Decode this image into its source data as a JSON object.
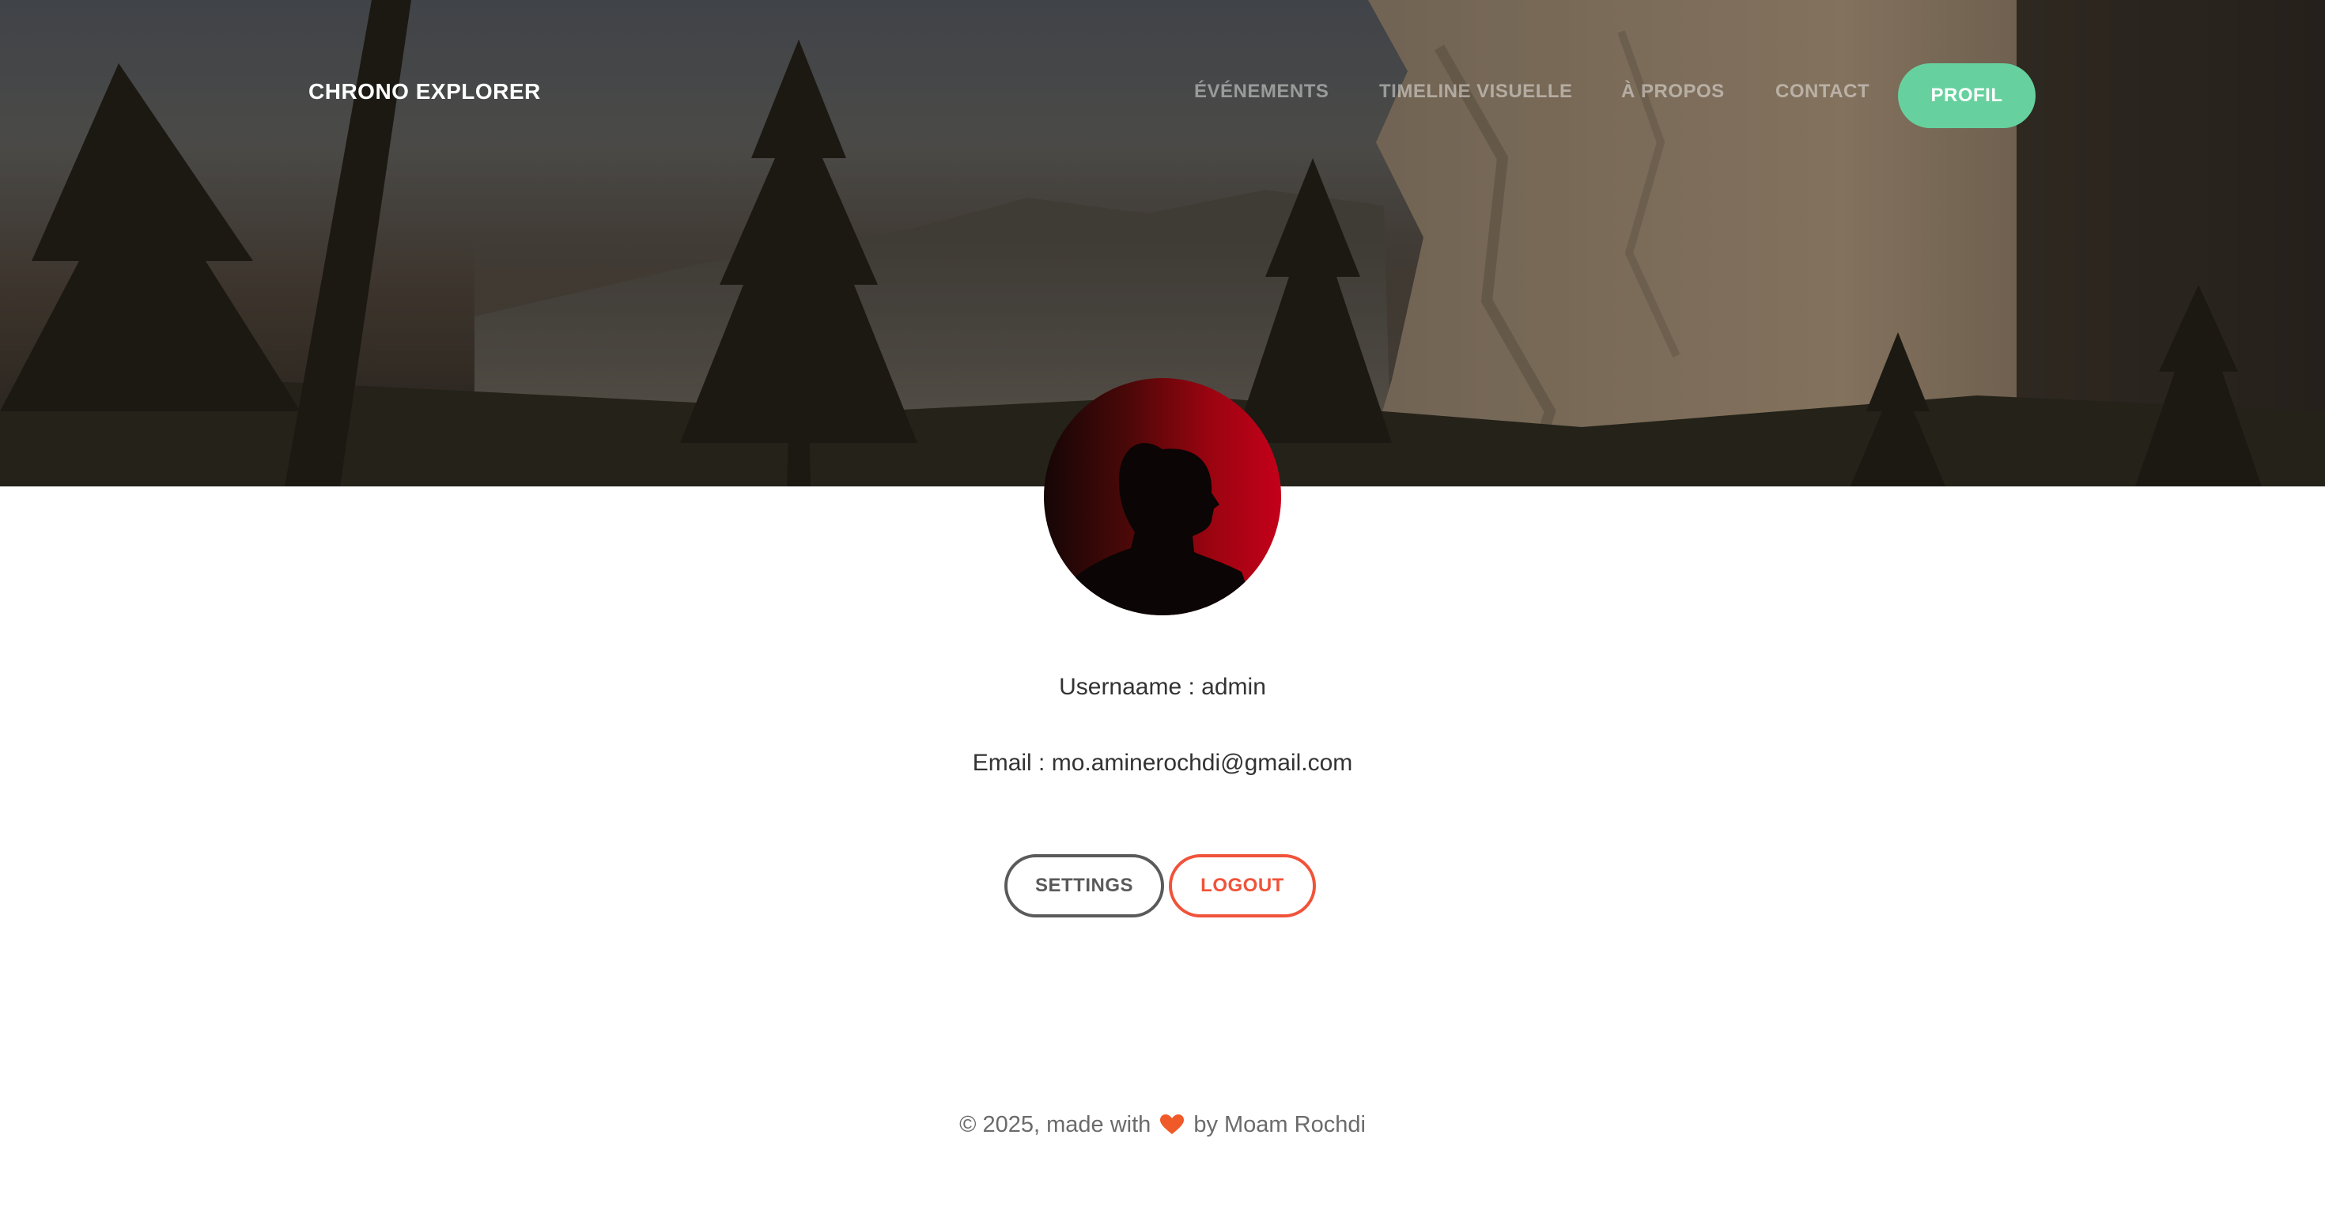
{
  "nav": {
    "brand": "CHRONO EXPLORER",
    "links": [
      {
        "label": "ÉVÉNEMENTS"
      },
      {
        "label": "TIMELINE VISUELLE"
      },
      {
        "label": "À PROPOS"
      },
      {
        "label": "CONTACT"
      }
    ],
    "profile_label": "PROFIL"
  },
  "profile": {
    "username_line": "Usernaame : admin",
    "email_line": "Email : mo.aminerochdi@gmail.com"
  },
  "actions": {
    "settings_label": "SETTINGS",
    "logout_label": "LOGOUT"
  },
  "footer": {
    "prefix": "© 2025, made with",
    "suffix": "by Moam Rochdi",
    "heart_icon": "heart-icon"
  },
  "colors": {
    "accent_green": "#66d19e",
    "logout_red": "#f0533a",
    "heart": "#f05a28"
  }
}
